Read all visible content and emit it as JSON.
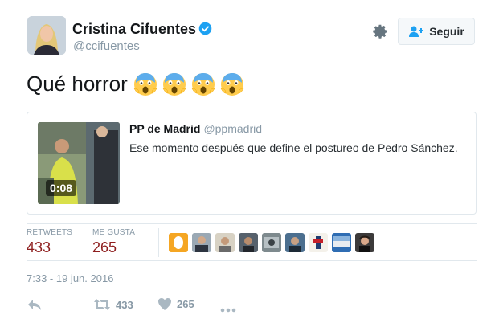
{
  "user": {
    "name": "Cristina Cifuentes",
    "handle": "@ccifuentes",
    "verified_icon": "verified-badge-icon"
  },
  "actions_top": {
    "settings_icon": "gear-icon",
    "follow_label": "Seguir"
  },
  "tweet": {
    "text": "Qué horror",
    "emoji_icon": "face-screaming-in-fear-icon",
    "emoji_count": 4
  },
  "quoted": {
    "name": "PP de Madrid",
    "handle": "@ppmadrid",
    "text": "Ese momento después que define el postureo de Pedro Sánchez.",
    "video_duration": "0:08"
  },
  "stats": {
    "retweets_label": "RETWEETS",
    "retweets": "433",
    "likes_label": "ME GUSTA",
    "likes": "265",
    "liker_avatar_count": 9
  },
  "timestamp": "7:33 - 19 jun. 2016",
  "footer": {
    "reply_icon": "reply-icon",
    "retweet_icon": "retweet-icon",
    "retweet_count": "433",
    "like_icon": "heart-icon",
    "like_count": "265",
    "more_icon": "more-dots-icon"
  },
  "colors": {
    "accent": "#1da1f2",
    "stat_value": "#8e1e1e",
    "muted": "#8899a6"
  }
}
